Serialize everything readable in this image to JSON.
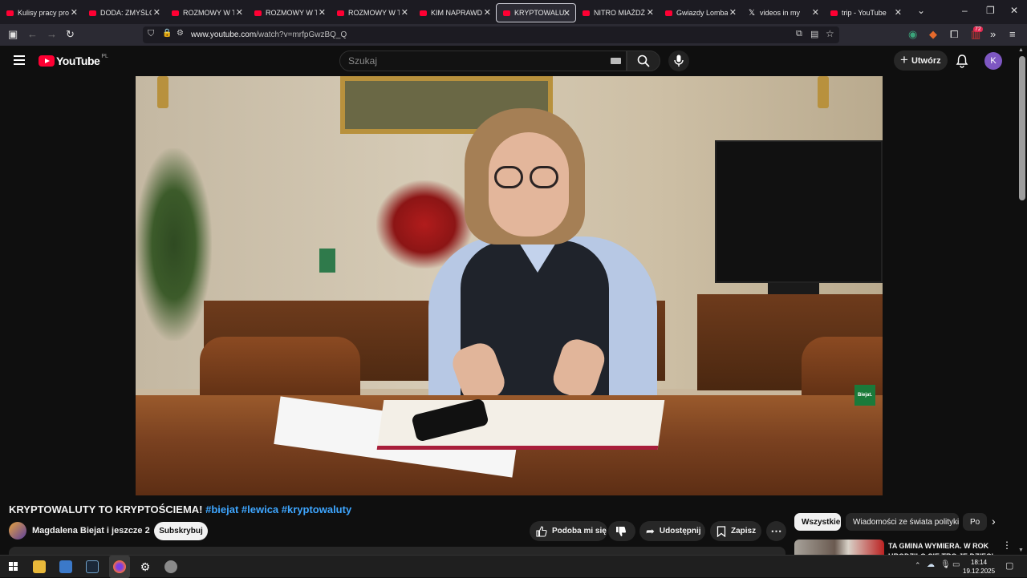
{
  "browser": {
    "tabs": [
      {
        "title": "Kulisy pracy prosty",
        "icon": "youtube-favicon"
      },
      {
        "title": "DODA: ZMYŚLONE",
        "icon": "youtube-favicon"
      },
      {
        "title": "ROZMOWY W TOI",
        "icon": "youtube-favicon"
      },
      {
        "title": "ROZMOWY W TOI",
        "icon": "youtube-favicon"
      },
      {
        "title": "ROZMOWY W TOI",
        "icon": "youtube-favicon"
      },
      {
        "title": "KIM NAPRAWDĘ JE",
        "icon": "youtube-favicon"
      },
      {
        "title": "KRYPTOWALUTY T",
        "icon": "youtube-favicon",
        "active": true
      },
      {
        "title": "NITRO MIAŻDŻY I",
        "icon": "youtube-favicon"
      },
      {
        "title": "Gwiazdy Lombardi",
        "icon": "youtube-favicon"
      },
      {
        "title": "videos in my",
        "icon": "x-favicon"
      },
      {
        "title": "trip - YouTube",
        "icon": "youtube-favicon"
      }
    ],
    "url_prefix": "www.youtube.com",
    "url_path": "/watch?v=mrfpGwzBQ_Q",
    "extension_badge": "72"
  },
  "youtube": {
    "logo_text": "YouTube",
    "country_code": "PL",
    "search_placeholder": "Szukaj",
    "create_label": "Utwórz",
    "avatar_letter": "K"
  },
  "video": {
    "watermark": "Biejat.",
    "title_main": "KRYPTOWALUTY TO KRYPTOŚCIEMA!",
    "hashtags": "#biejat #lewica #kryptowaluty",
    "channel": "Magdalena Biejat i jeszcze 2",
    "subscribe_label": "Subskrybuj",
    "like_label": "Podoba mi się",
    "share_label": "Udostępnij",
    "save_label": "Zapisz"
  },
  "sidebar": {
    "chips": [
      "Wszystkie",
      "Wiadomości ze świata polityki",
      "Po"
    ],
    "related_title": "TA GMINA WYMIERA. W ROK URODZIŁO SIĘ TRO JE DZIECI"
  },
  "taskbar": {
    "time": "18:14",
    "date": "19.12.2025"
  },
  "colors": {
    "youtube_red": "#ff0033",
    "link_blue": "#3ea6ff",
    "background": "#0f0f0f"
  }
}
